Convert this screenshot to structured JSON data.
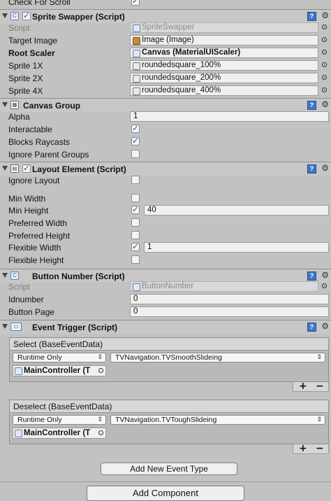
{
  "top": {
    "label": "Check For Scroll",
    "checked": true
  },
  "sprite_swapper": {
    "title": "Sprite Swapper (Script)",
    "script_label": "Script",
    "script_value": "SpriteSwapper",
    "target_image_label": "Target Image",
    "target_image_value": "Image (Image)",
    "root_scaler_label": "Root Scaler",
    "root_scaler_value": "Canvas (MaterialUIScaler)",
    "sprite1x_label": "Sprite 1X",
    "sprite1x_value": "roundedsquare_100%",
    "sprite2x_label": "Sprite 2X",
    "sprite2x_value": "roundedsquare_200%",
    "sprite4x_label": "Sprite 4X",
    "sprite4x_value": "roundedsquare_400%"
  },
  "canvas_group": {
    "title": "Canvas Group",
    "alpha_label": "Alpha",
    "alpha_value": "1",
    "interactable_label": "Interactable",
    "interactable": true,
    "blocks_raycasts_label": "Blocks Raycasts",
    "blocks_raycasts": true,
    "ignore_parent_label": "Ignore Parent Groups",
    "ignore_parent": false
  },
  "layout_element": {
    "title": "Layout Element (Script)",
    "ignore_layout_label": "Ignore Layout",
    "min_width_label": "Min Width",
    "min_height_label": "Min Height",
    "min_height_value": "40",
    "preferred_width_label": "Preferred Width",
    "preferred_height_label": "Preferred Height",
    "flexible_width_label": "Flexible Width",
    "flexible_width_value": "1",
    "flexible_height_label": "Flexible Height"
  },
  "button_number": {
    "title": "Button Number (Script)",
    "script_label": "Script",
    "script_value": "ButtonNumber",
    "idnumber_label": "Idnumber",
    "idnumber_value": "0",
    "button_page_label": "Button Page",
    "button_page_value": "0"
  },
  "event_trigger": {
    "title": "Event Trigger (Script)",
    "events": [
      {
        "header": "Select (BaseEventData)",
        "mode": "Runtime Only",
        "function": "TVNavigation.TVSmoothSlideing",
        "target": "MainController (T"
      },
      {
        "header": "Deselect (BaseEventData)",
        "mode": "Runtime Only",
        "function": "TVNavigation.TVToughSlideing",
        "target": "MainController (T"
      }
    ],
    "add_event_label": "Add New Event Type"
  },
  "add_component_label": "Add Component",
  "icons": {
    "help": "?",
    "gear": "⚙",
    "plus": "+",
    "minus": "−",
    "arrow": "⇕"
  }
}
